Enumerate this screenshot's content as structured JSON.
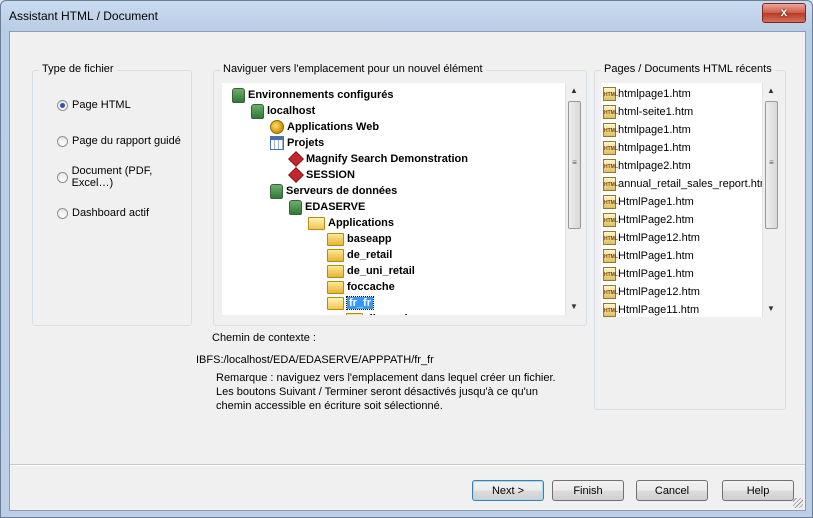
{
  "window": {
    "title": "Assistant HTML / Document",
    "close_label": "x"
  },
  "file_type": {
    "title": "Type de fichier",
    "options": [
      {
        "label": "Page HTML",
        "checked": true
      },
      {
        "label": "Page du rapport guidé",
        "checked": false
      },
      {
        "label": "Document (PDF, Excel…)",
        "checked": false
      },
      {
        "label": "Dashboard actif",
        "checked": false
      }
    ]
  },
  "navigator": {
    "title": "Naviguer vers l'emplacement pour un nouvel élément",
    "tree": [
      {
        "label": "Environnements configurés",
        "icon": "database-icon",
        "depth": 0
      },
      {
        "label": "localhost",
        "icon": "database-icon",
        "depth": 1
      },
      {
        "label": "Applications Web",
        "icon": "globe-icon",
        "depth": 2
      },
      {
        "label": "Projets",
        "icon": "calendar-icon",
        "depth": 2
      },
      {
        "label": "Magnify Search Demonstration",
        "icon": "project-icon",
        "depth": 3
      },
      {
        "label": "SESSION",
        "icon": "project-icon",
        "depth": 3
      },
      {
        "label": "Serveurs de données",
        "icon": "database-icon",
        "depth": 2
      },
      {
        "label": "EDASERVE",
        "icon": "database-icon",
        "depth": 3
      },
      {
        "label": "Applications",
        "icon": "folder-open-icon",
        "depth": 4
      },
      {
        "label": "baseapp",
        "icon": "folder-icon",
        "depth": 5
      },
      {
        "label": "de_retail",
        "icon": "folder-icon",
        "depth": 5
      },
      {
        "label": "de_uni_retail",
        "icon": "folder-icon",
        "depth": 5
      },
      {
        "label": "foccache",
        "icon": "folder-icon",
        "depth": 5
      },
      {
        "label": "fr_fr",
        "icon": "folder-open-icon",
        "depth": 5,
        "selected": true
      },
      {
        "label": "dimensions",
        "icon": "folder-icon",
        "depth": 6
      }
    ]
  },
  "context": {
    "label": "Chemin de contexte :",
    "path": "IBFS:/localhost/EDA/EDASERVE/APPPATH/fr_fr",
    "note": "Remarque : naviguez vers l'emplacement dans lequel créer un fichier. Les boutons Suivant / Terminer seront désactivés jusqu'à ce qu'un chemin accessible en écriture soit sélectionné."
  },
  "recent": {
    "title": "Pages / Documents HTML récents",
    "items": [
      "htmlpage1.htm",
      "html-seite1.htm",
      "htmlpage1.htm",
      "htmlpage1.htm",
      "htmlpage2.htm",
      "annual_retail_sales_report.htm",
      "HtmlPage1.htm",
      "HtmlPage2.htm",
      "HtmlPage12.htm",
      "HtmlPage1.htm",
      "HtmlPage1.htm",
      "HtmlPage12.htm",
      "HtmlPage11.htm"
    ],
    "icon_label": "HTML"
  },
  "buttons": {
    "next": "Next >",
    "finish": "Finish",
    "cancel": "Cancel",
    "help": "Help"
  }
}
